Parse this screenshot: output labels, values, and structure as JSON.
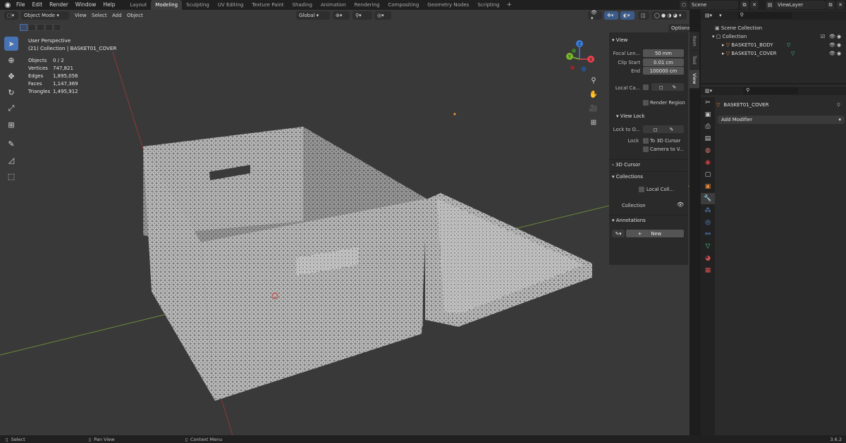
{
  "menu": [
    "File",
    "Edit",
    "Render",
    "Window",
    "Help"
  ],
  "workspaces": [
    "Layout",
    "Modeling",
    "Sculpting",
    "UV Editing",
    "Texture Paint",
    "Shading",
    "Animation",
    "Rendering",
    "Compositing",
    "Geometry Nodes",
    "Scripting"
  ],
  "workspace_active": "Modeling",
  "workspace_add": "+",
  "scene": "Scene",
  "view_layer": "ViewLayer",
  "viewport_header": {
    "mode": "Object Mode",
    "menus": [
      "View",
      "Select",
      "Add",
      "Object"
    ],
    "orientation": "Global",
    "options": "Options"
  },
  "overlay": {
    "view_name": "User Perspective",
    "collection_info": "(21) Collection | BASKET01_COVER",
    "stats": [
      {
        "label": "Objects",
        "value": "0 / 2"
      },
      {
        "label": "Vertices",
        "value": "747,821"
      },
      {
        "label": "Edges",
        "value": "1,895,056"
      },
      {
        "label": "Faces",
        "value": "1,147,369"
      },
      {
        "label": "Triangles",
        "value": "1,495,912"
      }
    ]
  },
  "gizmo": {
    "x": "X",
    "y": "Y",
    "z": "Z"
  },
  "npanel": {
    "view_title": "View",
    "focal_label": "Focal Len...",
    "focal_value": "50 mm",
    "clip_start_label": "Clip Start",
    "clip_start_value": "0.01 cm",
    "end_label": "End",
    "end_value": "100000 cm",
    "local_camera_label": "Local Ca...",
    "render_region": "Render Region",
    "view_lock_title": "View Lock",
    "lock_to_label": "Lock to O...",
    "lock_label": "Lock",
    "to_3d_cursor": "To 3D Cursor",
    "camera_to_view": "Camera to V...",
    "cursor_title": "3D Cursor",
    "collections_title": "Collections",
    "local_coll": "Local Coll...",
    "collection_label": "Collection",
    "annotations_title": "Annotations",
    "new_label": "New",
    "tabs": [
      "Item",
      "Tool",
      "View"
    ]
  },
  "outliner": {
    "root": "Scene Collection",
    "collection": "Collection",
    "objects": [
      "BASKET01_BODY",
      "BASKET01_COVER"
    ]
  },
  "properties": {
    "object_name": "BASKET01_COVER",
    "add_modifier": "Add Modifier"
  },
  "statusbar": {
    "select": "Select",
    "pan": "Pan View",
    "context": "Context Menu",
    "version": "3.6.2"
  },
  "colors": {
    "accent": "#4772b3",
    "x_axis": "#e4424c",
    "y_axis": "#7ab82d",
    "z_axis": "#3a7ee0"
  }
}
